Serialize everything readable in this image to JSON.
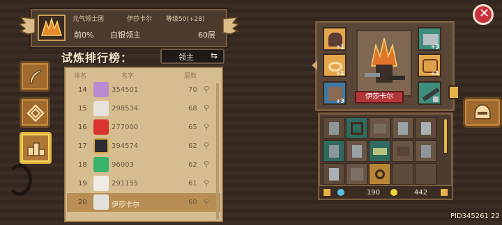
{
  "banner": {
    "guild": "元气领士团",
    "player": "伊莎卡尔",
    "level": "等级50(+28)",
    "percentile": "前0%",
    "rank_tier": "白银领主",
    "floors": "60层"
  },
  "leaderboard": {
    "title": "试炼排行榜：",
    "scope_label": "领主",
    "headers": [
      "排名",
      "名字",
      "层数"
    ],
    "rows": [
      {
        "rank": "14",
        "name": "354501",
        "floor": "70"
      },
      {
        "rank": "15",
        "name": "298534",
        "floor": "68"
      },
      {
        "rank": "16",
        "name": "277000",
        "floor": "65"
      },
      {
        "rank": "17",
        "name": "394574",
        "floor": "62"
      },
      {
        "rank": "18",
        "name": "96003",
        "floor": "62"
      },
      {
        "rank": "19",
        "name": "291155",
        "floor": "61"
      },
      {
        "rank": "20",
        "name": "伊莎卡尔",
        "floor": "60"
      }
    ]
  },
  "character": {
    "name": "伊莎卡尔",
    "slots": [
      {
        "icon": "helmet-icon",
        "bonus": "+1"
      },
      {
        "icon": "gauntlet-icon",
        "bonus": "+3"
      },
      {
        "icon": "ring-icon",
        "bonus": "+1"
      },
      {
        "icon": "pet-icon",
        "bonus": "+1"
      },
      {
        "icon": "armor-icon",
        "bonus": "+3"
      },
      {
        "icon": "weapon-icon",
        "bonus": ""
      }
    ]
  },
  "inventory": {
    "gems": "190",
    "gold": "442"
  },
  "player_id": "PID345261 22",
  "colors": {
    "accent_gold": "#e0b344",
    "panel_brown": "#5a4636",
    "name_red": "#b3373a",
    "close_red": "#c8303a"
  }
}
